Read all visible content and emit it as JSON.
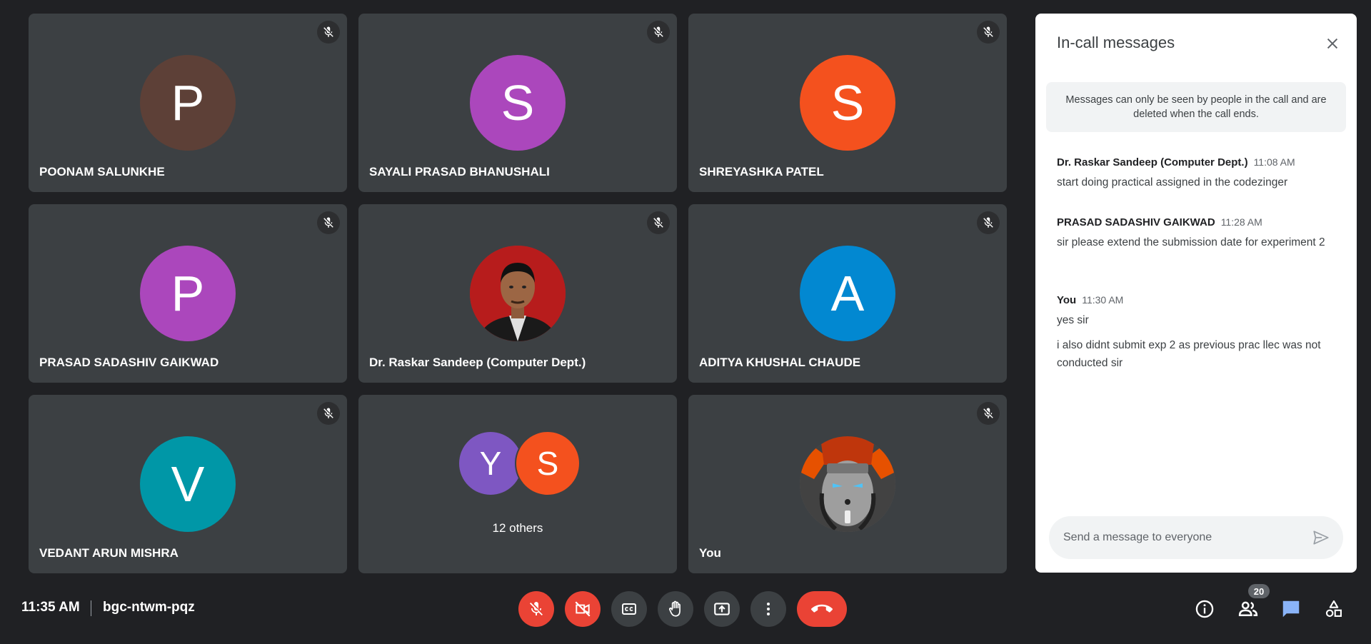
{
  "participants": [
    {
      "name": "POONAM SALUNKHE",
      "initial": "P",
      "color": "#5d4037"
    },
    {
      "name": "SAYALI PRASAD BHANUSHALI",
      "initial": "S",
      "color": "#ab47bc"
    },
    {
      "name": "SHREYASHKA PATEL",
      "initial": "S",
      "color": "#f4511e"
    },
    {
      "name": "PRASAD SADASHIV GAIKWAD",
      "initial": "P",
      "color": "#ab47bc"
    },
    {
      "name": "Dr. Raskar Sandeep (Computer Dept.)",
      "initial": "",
      "color": "#c62828"
    },
    {
      "name": "ADITYA KHUSHAL CHAUDE",
      "initial": "A",
      "color": "#0288d1"
    },
    {
      "name": "VEDANT ARUN MISHRA",
      "initial": "V",
      "color": "#0097a7"
    },
    {
      "name": "",
      "initial": "",
      "color": ""
    },
    {
      "name": "You",
      "initial": "",
      "color": "#9e9e9e"
    }
  ],
  "others": {
    "avatars": [
      {
        "initial": "Y",
        "color": "#7e57c2"
      },
      {
        "initial": "S",
        "color": "#f4511e"
      }
    ],
    "label": "12 others"
  },
  "chat": {
    "title": "In-call messages",
    "notice": "Messages can only be seen by people in the call and are deleted when the call ends.",
    "messages": [
      {
        "sender": "Dr. Raskar Sandeep (Computer Dept.)",
        "time": "11:08 AM",
        "texts": [
          "start doing practical assigned in the codezinger"
        ]
      },
      {
        "sender": "PRASAD SADASHIV GAIKWAD",
        "time": "11:28 AM",
        "texts": [
          "sir please extend the submission date for experiment 2"
        ]
      },
      {
        "sender": "You",
        "time": "11:30 AM",
        "texts": [
          "yes sir",
          "i also didnt submit exp 2 as previous prac llec was not conducted sir"
        ]
      }
    ],
    "input_placeholder": "Send a message to everyone"
  },
  "bottom": {
    "time": "11:35 AM",
    "meeting_code": "bgc-ntwm-pqz",
    "people_count": "20"
  },
  "colors": {
    "accent": "#8ab4f8",
    "danger": "#ea4335"
  }
}
